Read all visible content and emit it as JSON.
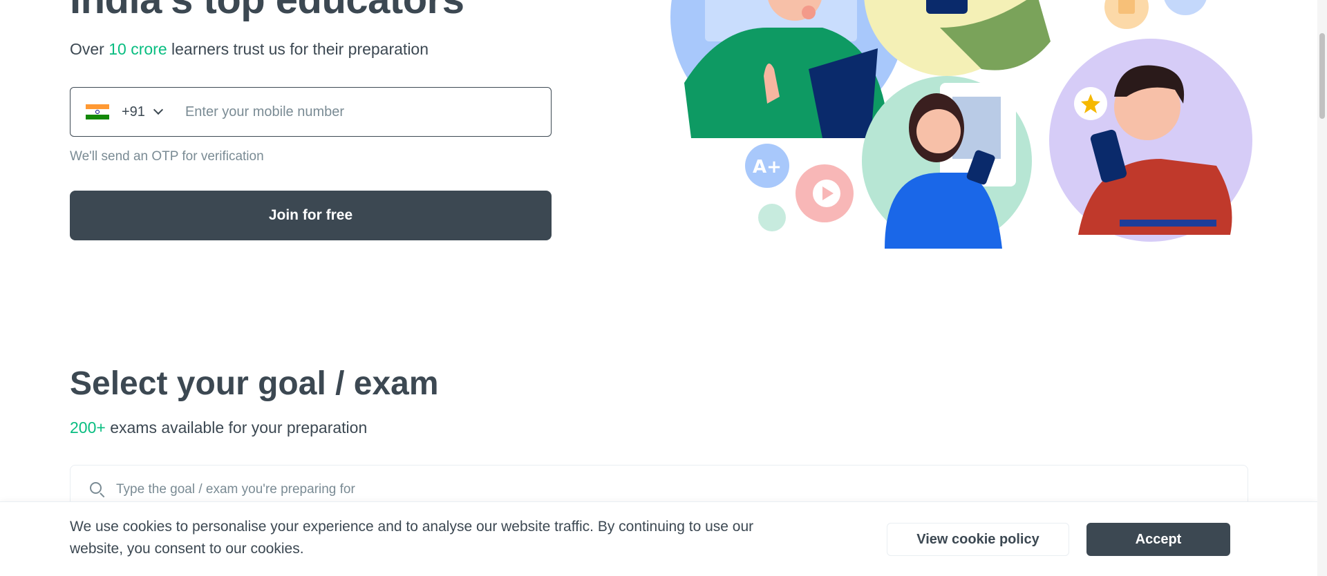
{
  "hero": {
    "title": "India's top educators",
    "sub_prefix": "Over ",
    "sub_highlight": "10 crore",
    "sub_suffix": " learners trust us for their preparation"
  },
  "signup": {
    "country_code": "+91",
    "phone_placeholder": "Enter your mobile number",
    "otp_note": "We'll send an OTP for verification",
    "join_label": "Join for free"
  },
  "goal": {
    "title": "Select your goal / exam",
    "sub_highlight": "200+",
    "sub_suffix": " exams available for your preparation",
    "search_placeholder": "Type the goal / exam you're preparing for"
  },
  "cookie": {
    "text": "We use cookies to personalise your experience and to analyse our website traffic. By continuing to use our website, you consent to our cookies.",
    "policy_label": "View cookie policy",
    "accept_label": "Accept"
  },
  "colors": {
    "primary_text": "#3c4852",
    "accent_green": "#08bd80",
    "muted_text": "#7a8b94",
    "button_dark": "#3c4852"
  },
  "icons": [
    "india-flag-icon",
    "chevron-down-icon",
    "search-icon"
  ]
}
